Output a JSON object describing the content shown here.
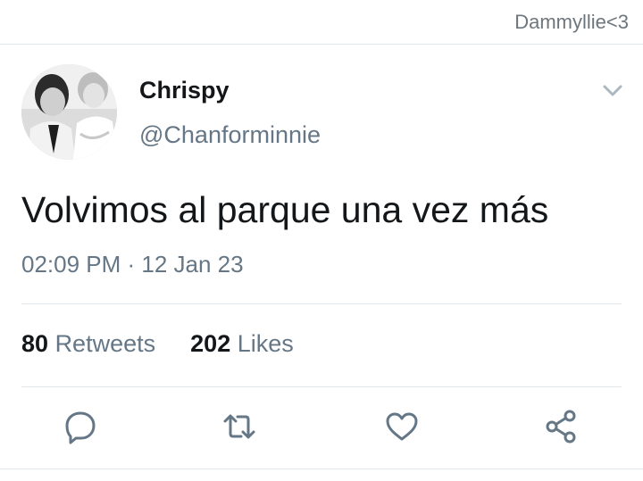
{
  "watermark": "Dammyllie<3",
  "tweet": {
    "display_name": "Chrispy",
    "handle": "@Chanforminnie",
    "text": "Volvimos al parque una vez más",
    "timestamp": "02:09 PM · 12 Jan 23",
    "retweets": {
      "count": "80",
      "label": "Retweets"
    },
    "likes": {
      "count": "202",
      "label": "Likes"
    }
  },
  "icons": {
    "avatar": "profile-photo",
    "menu": "chevron-down-icon",
    "reply": "reply-icon",
    "retweet": "retweet-icon",
    "like": "heart-icon",
    "share": "share-icon"
  },
  "colors": {
    "text_primary": "#14171a",
    "text_secondary": "#657786",
    "icon": "#657786",
    "divider": "#e1e8ed"
  }
}
